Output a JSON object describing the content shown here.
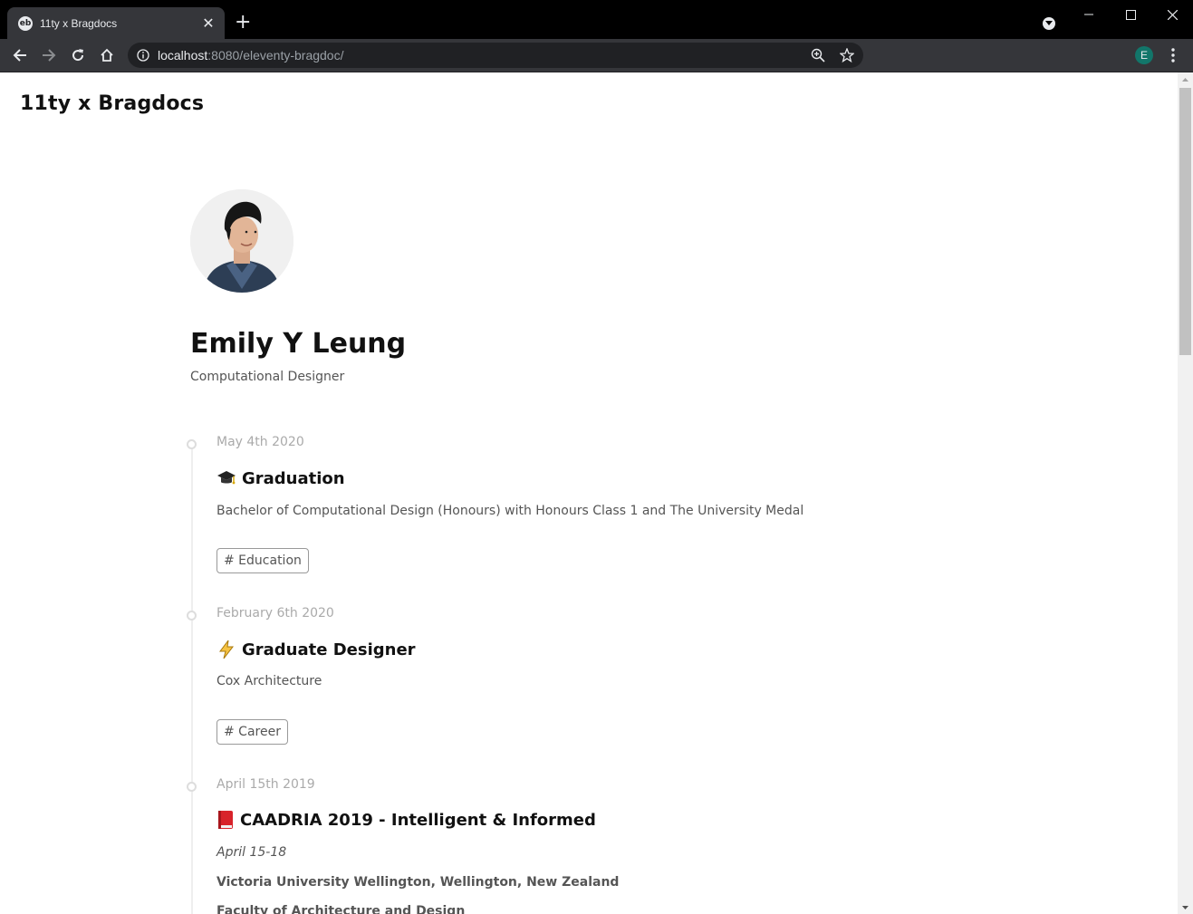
{
  "browser": {
    "tab_title": "11ty x Bragdocs",
    "favicon_text": "eb",
    "url_host": "localhost",
    "url_rest": ":8080/eleventy-bragdoc/",
    "profile_initial": "E"
  },
  "site": {
    "title": "11ty x Bragdocs"
  },
  "profile": {
    "name": "Emily Y Leung",
    "role": "Computational Designer"
  },
  "entries": [
    {
      "date": "May 4th 2020",
      "emoji_icon": "graduation-cap-icon",
      "title": "Graduation",
      "description": "Bachelor of Computational Design (Honours) with Honours Class 1 and The University Medal",
      "tag": "# Education"
    },
    {
      "date": "February 6th 2020",
      "emoji_icon": "lightning-icon",
      "title": "Graduate Designer",
      "description": "Cox Architecture",
      "tag": "# Career"
    },
    {
      "date": "April 15th 2019",
      "emoji_icon": "red-book-icon",
      "title": "CAADRIA 2019 - Intelligent & Informed",
      "dates_line": "April 15-18",
      "venue": "Victoria University Wellington, Wellington, New Zealand",
      "faculty": "Faculty of Architecture and Design"
    }
  ]
}
